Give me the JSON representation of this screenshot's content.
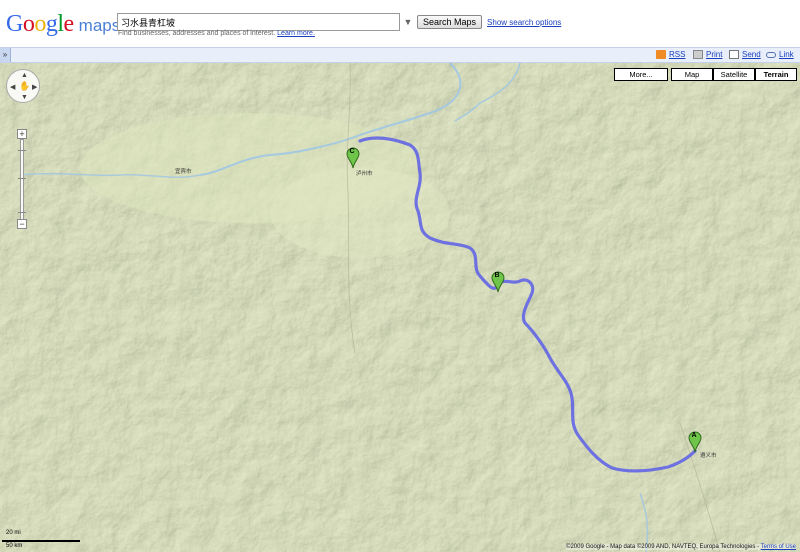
{
  "header": {
    "logo_google": "Google",
    "logo_maps": "maps",
    "search_value": "习水县青杠坡",
    "search_button": "Search Maps",
    "search_options": "Show search options",
    "hint_text": "Find businesses, addresses and places of interest.",
    "hint_link": "Learn more."
  },
  "toolbar": {
    "collapse_label": "»",
    "rss": "RSS",
    "print": "Print",
    "send": "Send",
    "link": "Link"
  },
  "map": {
    "more_button": "More...",
    "map_types": [
      "Map",
      "Satellite",
      "Terrain"
    ],
    "active_map_type": "Terrain",
    "markers": [
      "A",
      "B",
      "C"
    ],
    "towns": [
      "遵义市",
      "泸州市",
      "宜宾市"
    ],
    "scale_label_top": "20 mi",
    "scale_label_bottom": "50 km",
    "copyright": "©2009 Google - Map data ©2009 AND, NAVTEQ, Europa Technologies -",
    "terms": "Terms of Use",
    "route_color": "#5a5ee8",
    "marker_color": "#6fc44a"
  }
}
